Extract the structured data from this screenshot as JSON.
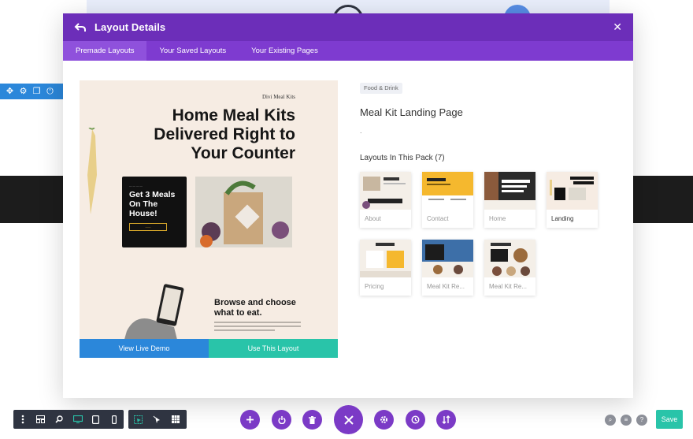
{
  "modal": {
    "title": "Layout Details",
    "tabs": [
      {
        "label": "Premade Layouts",
        "active": true
      },
      {
        "label": "Your Saved Layouts",
        "active": false
      },
      {
        "label": "Your Existing Pages",
        "active": false
      }
    ]
  },
  "preview": {
    "brand": "Divi Meal Kits",
    "headline": "Home Meal Kits Delivered Right to Your Counter",
    "card_title": "Get 3 Meals On The House!",
    "subheadline": "Browse and choose what to eat."
  },
  "actions": {
    "demo_label": "View Live Demo",
    "use_label": "Use This Layout"
  },
  "details": {
    "category": "Food & Drink",
    "layout_name": "Meal Kit Landing Page",
    "description": ".",
    "pack_title": "Layouts In This Pack (7)"
  },
  "pack": [
    {
      "label": "About"
    },
    {
      "label": "Contact"
    },
    {
      "label": "Home"
    },
    {
      "label": "Landing",
      "selected": true
    },
    {
      "label": "Pricing"
    },
    {
      "label": "Meal Kit Re..."
    },
    {
      "label": "Meal Kit Re..."
    }
  ],
  "footer": {
    "save_label": "Save"
  },
  "colors": {
    "header": "#6c2eb9",
    "tabs": "#7e3bd0",
    "blue": "#2b87da",
    "teal": "#29c4a9",
    "builder_dark": "#2f3441"
  }
}
